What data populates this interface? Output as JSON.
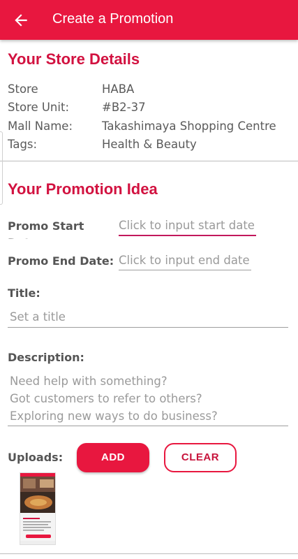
{
  "header": {
    "title": "Create a Promotion"
  },
  "store_section": {
    "title": "Your Store Details",
    "rows": [
      {
        "label": "Store",
        "value": "HABA"
      },
      {
        "label": "Store Unit:",
        "value": "#B2-37"
      },
      {
        "label": "Mall Name:",
        "value": "Takashimaya Shopping Centre"
      },
      {
        "label": "Tags:",
        "value": "Health & Beauty"
      }
    ]
  },
  "promo_section": {
    "title": "Your Promotion Idea",
    "start_date": {
      "label": "Promo Start Date:",
      "placeholder": "Click to input start date"
    },
    "end_date": {
      "label": "Promo End Date:",
      "placeholder": "Click to input end date"
    },
    "title_field": {
      "label": "Title:",
      "placeholder": "Set a title"
    },
    "description": {
      "label": "Description:",
      "placeholder_lines": [
        "Need help with something?",
        "Got customers to refer to others?",
        "Exploring new ways to do business?"
      ]
    },
    "uploads": {
      "label": "Uploads:",
      "add_label": "ADD",
      "clear_label": "CLEAR"
    }
  },
  "colors": {
    "primary": "#e8173f",
    "heading": "#d21240",
    "active_underline": "#c2185b"
  },
  "icons": {
    "back": "arrow-left-icon"
  }
}
